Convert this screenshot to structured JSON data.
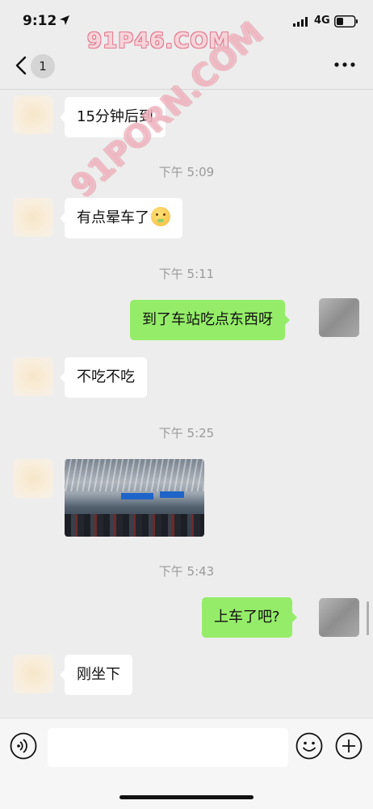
{
  "status_bar": {
    "time": "9:12",
    "network": "4G"
  },
  "watermark": {
    "top": "91P46.COM",
    "diagonal": "91PORN.COM"
  },
  "header": {
    "unread_count": "1"
  },
  "messages": [
    {
      "side": "left",
      "text": "15分钟后到"
    },
    {
      "timestamp": "下午 5:09"
    },
    {
      "side": "left",
      "text": "有点晕车了",
      "emoji": "nauseated-face"
    },
    {
      "timestamp": "下午 5:11"
    },
    {
      "side": "right",
      "text": "到了车站吃点东西呀"
    },
    {
      "side": "left",
      "text": "不吃不吃"
    },
    {
      "timestamp": "下午 5:25"
    },
    {
      "side": "left",
      "type": "image"
    },
    {
      "timestamp": "下午 5:43"
    },
    {
      "side": "right",
      "text": "上车了吧?"
    },
    {
      "side": "left",
      "text": "刚坐下"
    }
  ],
  "colors": {
    "background": "#ededed",
    "bubble_left": "#ffffff",
    "bubble_right": "#95ec69",
    "timestamp": "#9a9a9a"
  },
  "icons": {
    "back": "chevron-left-icon",
    "more": "more-dots-icon",
    "voice": "voice-icon",
    "emoji": "emoji-icon",
    "plus": "plus-icon"
  }
}
